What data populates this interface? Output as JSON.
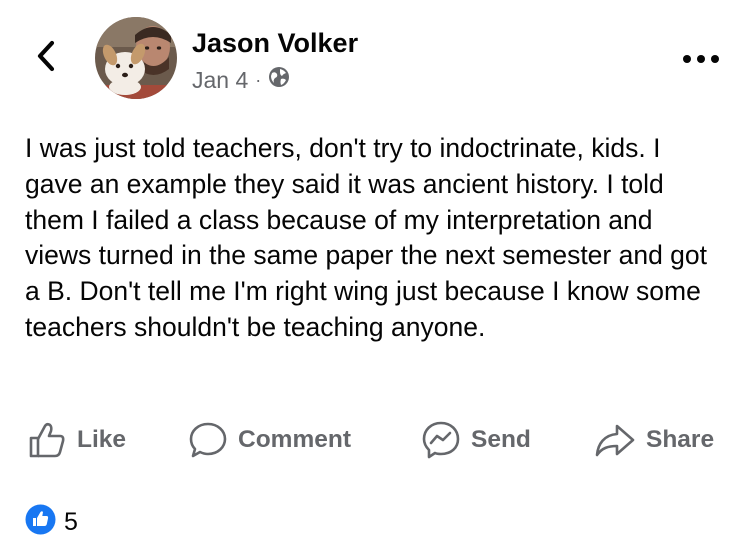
{
  "post": {
    "author": "Jason Volker",
    "date": "Jan 4",
    "separator": "·",
    "audience_icon": "globe-icon",
    "text": "I was just told teachers, don't try to indoctrinate, kids. I gave an example they said it was ancient history. I told them I failed a class because of my interpretation and views turned in the same paper the next semester and got a B. Don't tell me I'm right wing just because I know some teachers shouldn't be teaching anyone."
  },
  "header": {
    "back_icon": "chevron-left-icon",
    "more_icon": "more-horizontal-icon"
  },
  "actions": [
    {
      "id": "like",
      "label": "Like",
      "icon": "thumbs-up-icon"
    },
    {
      "id": "comment",
      "label": "Comment",
      "icon": "comment-bubble-icon"
    },
    {
      "id": "send",
      "label": "Send",
      "icon": "messenger-icon"
    },
    {
      "id": "share",
      "label": "Share",
      "icon": "share-arrow-icon"
    }
  ],
  "reactions": {
    "icon": "like-reaction-icon",
    "count": "5"
  },
  "colors": {
    "text_primary": "#050505",
    "text_secondary": "#65676b",
    "like_blue": "#1877f2"
  }
}
